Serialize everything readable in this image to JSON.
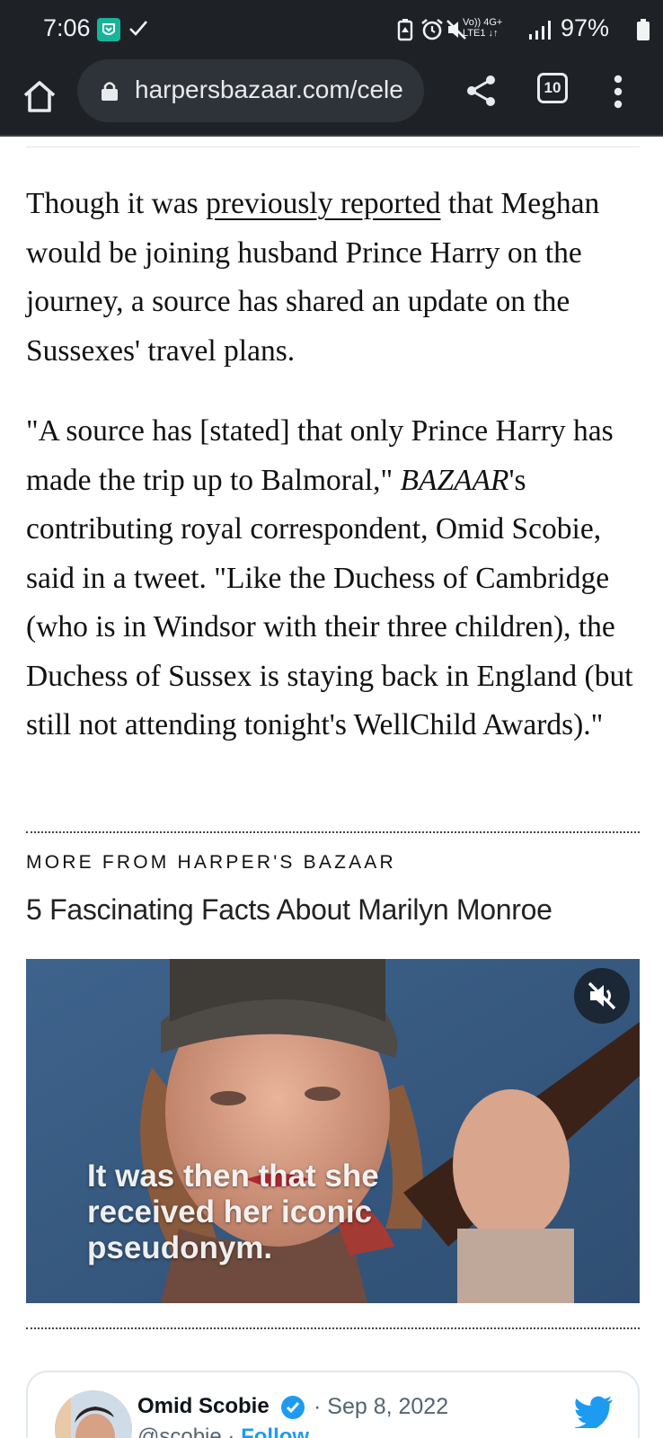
{
  "status_bar": {
    "time": "7:06",
    "network_top": "Vo)) 4G+",
    "network_bottom": "LTE1 ↓↑",
    "battery": "97%"
  },
  "browser": {
    "url": "harpersbazaar.com/cele",
    "tab_count": "10"
  },
  "article": {
    "para1_before_link": "Though it was ",
    "para1_link": "previously reported",
    "para1_after_link": " that Meghan would be joining husband Prince Harry on the journey, a source has shared an update on the Sussexes' travel plans.",
    "para2_before_em": "\"A source has [stated] that only Prince Harry has made the trip up to Balmoral,\" ",
    "para2_em": "BAZAAR",
    "para2_after_em": "'s contributing royal correspondent, Omid Scobie, said in a tweet. \"Like the Duchess of Cambridge (who is in Windsor with their three children), the Duchess of Sussex is staying back in England (but still not attending tonight's WellChild Awards).\""
  },
  "more_from": {
    "heading": "MORE FROM HARPER'S BAZAAR",
    "title": "5 Fascinating Facts About Marilyn Monroe",
    "video_caption": "It was then that she received her iconic pseudonym."
  },
  "tweet": {
    "name": "Omid Scobie",
    "date": "· Sep 8, 2022",
    "handle": "@scobie · ",
    "follow": "Follow"
  },
  "icons": {
    "status": [
      "notification-app-icon",
      "check-icon",
      "battery-saver-icon",
      "alarm-icon",
      "mute-icon",
      "signal-icon",
      "battery-icon"
    ],
    "toolbar": [
      "home-icon",
      "lock-icon",
      "share-icon",
      "tabs-icon",
      "more-vert-icon"
    ],
    "video": [
      "volume-muted-icon"
    ],
    "tweet": [
      "verified-icon",
      "twitter-bird-icon"
    ]
  },
  "colors": {
    "chrome_dark": "#1e2227",
    "url_box": "#2e3339",
    "notif_green": "#18b39b",
    "twitter_blue": "#1d9bf0"
  }
}
